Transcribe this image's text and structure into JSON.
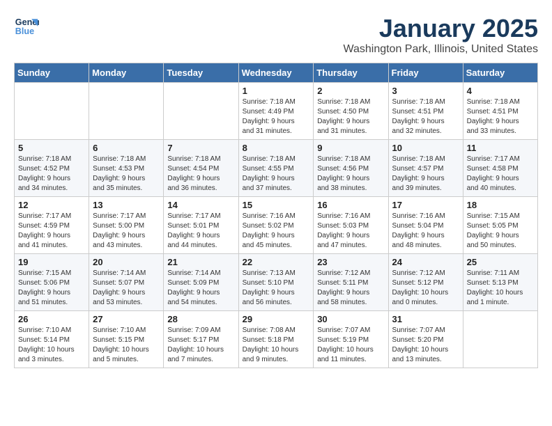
{
  "logo": {
    "line1": "General",
    "line2": "Blue"
  },
  "title": "January 2025",
  "subtitle": "Washington Park, Illinois, United States",
  "weekdays": [
    "Sunday",
    "Monday",
    "Tuesday",
    "Wednesday",
    "Thursday",
    "Friday",
    "Saturday"
  ],
  "weeks": [
    [
      {
        "day": "",
        "info": ""
      },
      {
        "day": "",
        "info": ""
      },
      {
        "day": "",
        "info": ""
      },
      {
        "day": "1",
        "info": "Sunrise: 7:18 AM\nSunset: 4:49 PM\nDaylight: 9 hours\nand 31 minutes."
      },
      {
        "day": "2",
        "info": "Sunrise: 7:18 AM\nSunset: 4:50 PM\nDaylight: 9 hours\nand 31 minutes."
      },
      {
        "day": "3",
        "info": "Sunrise: 7:18 AM\nSunset: 4:51 PM\nDaylight: 9 hours\nand 32 minutes."
      },
      {
        "day": "4",
        "info": "Sunrise: 7:18 AM\nSunset: 4:51 PM\nDaylight: 9 hours\nand 33 minutes."
      }
    ],
    [
      {
        "day": "5",
        "info": "Sunrise: 7:18 AM\nSunset: 4:52 PM\nDaylight: 9 hours\nand 34 minutes."
      },
      {
        "day": "6",
        "info": "Sunrise: 7:18 AM\nSunset: 4:53 PM\nDaylight: 9 hours\nand 35 minutes."
      },
      {
        "day": "7",
        "info": "Sunrise: 7:18 AM\nSunset: 4:54 PM\nDaylight: 9 hours\nand 36 minutes."
      },
      {
        "day": "8",
        "info": "Sunrise: 7:18 AM\nSunset: 4:55 PM\nDaylight: 9 hours\nand 37 minutes."
      },
      {
        "day": "9",
        "info": "Sunrise: 7:18 AM\nSunset: 4:56 PM\nDaylight: 9 hours\nand 38 minutes."
      },
      {
        "day": "10",
        "info": "Sunrise: 7:18 AM\nSunset: 4:57 PM\nDaylight: 9 hours\nand 39 minutes."
      },
      {
        "day": "11",
        "info": "Sunrise: 7:17 AM\nSunset: 4:58 PM\nDaylight: 9 hours\nand 40 minutes."
      }
    ],
    [
      {
        "day": "12",
        "info": "Sunrise: 7:17 AM\nSunset: 4:59 PM\nDaylight: 9 hours\nand 41 minutes."
      },
      {
        "day": "13",
        "info": "Sunrise: 7:17 AM\nSunset: 5:00 PM\nDaylight: 9 hours\nand 43 minutes."
      },
      {
        "day": "14",
        "info": "Sunrise: 7:17 AM\nSunset: 5:01 PM\nDaylight: 9 hours\nand 44 minutes."
      },
      {
        "day": "15",
        "info": "Sunrise: 7:16 AM\nSunset: 5:02 PM\nDaylight: 9 hours\nand 45 minutes."
      },
      {
        "day": "16",
        "info": "Sunrise: 7:16 AM\nSunset: 5:03 PM\nDaylight: 9 hours\nand 47 minutes."
      },
      {
        "day": "17",
        "info": "Sunrise: 7:16 AM\nSunset: 5:04 PM\nDaylight: 9 hours\nand 48 minutes."
      },
      {
        "day": "18",
        "info": "Sunrise: 7:15 AM\nSunset: 5:05 PM\nDaylight: 9 hours\nand 50 minutes."
      }
    ],
    [
      {
        "day": "19",
        "info": "Sunrise: 7:15 AM\nSunset: 5:06 PM\nDaylight: 9 hours\nand 51 minutes."
      },
      {
        "day": "20",
        "info": "Sunrise: 7:14 AM\nSunset: 5:07 PM\nDaylight: 9 hours\nand 53 minutes."
      },
      {
        "day": "21",
        "info": "Sunrise: 7:14 AM\nSunset: 5:09 PM\nDaylight: 9 hours\nand 54 minutes."
      },
      {
        "day": "22",
        "info": "Sunrise: 7:13 AM\nSunset: 5:10 PM\nDaylight: 9 hours\nand 56 minutes."
      },
      {
        "day": "23",
        "info": "Sunrise: 7:12 AM\nSunset: 5:11 PM\nDaylight: 9 hours\nand 58 minutes."
      },
      {
        "day": "24",
        "info": "Sunrise: 7:12 AM\nSunset: 5:12 PM\nDaylight: 10 hours\nand 0 minutes."
      },
      {
        "day": "25",
        "info": "Sunrise: 7:11 AM\nSunset: 5:13 PM\nDaylight: 10 hours\nand 1 minute."
      }
    ],
    [
      {
        "day": "26",
        "info": "Sunrise: 7:10 AM\nSunset: 5:14 PM\nDaylight: 10 hours\nand 3 minutes."
      },
      {
        "day": "27",
        "info": "Sunrise: 7:10 AM\nSunset: 5:15 PM\nDaylight: 10 hours\nand 5 minutes."
      },
      {
        "day": "28",
        "info": "Sunrise: 7:09 AM\nSunset: 5:17 PM\nDaylight: 10 hours\nand 7 minutes."
      },
      {
        "day": "29",
        "info": "Sunrise: 7:08 AM\nSunset: 5:18 PM\nDaylight: 10 hours\nand 9 minutes."
      },
      {
        "day": "30",
        "info": "Sunrise: 7:07 AM\nSunset: 5:19 PM\nDaylight: 10 hours\nand 11 minutes."
      },
      {
        "day": "31",
        "info": "Sunrise: 7:07 AM\nSunset: 5:20 PM\nDaylight: 10 hours\nand 13 minutes."
      },
      {
        "day": "",
        "info": ""
      }
    ]
  ]
}
